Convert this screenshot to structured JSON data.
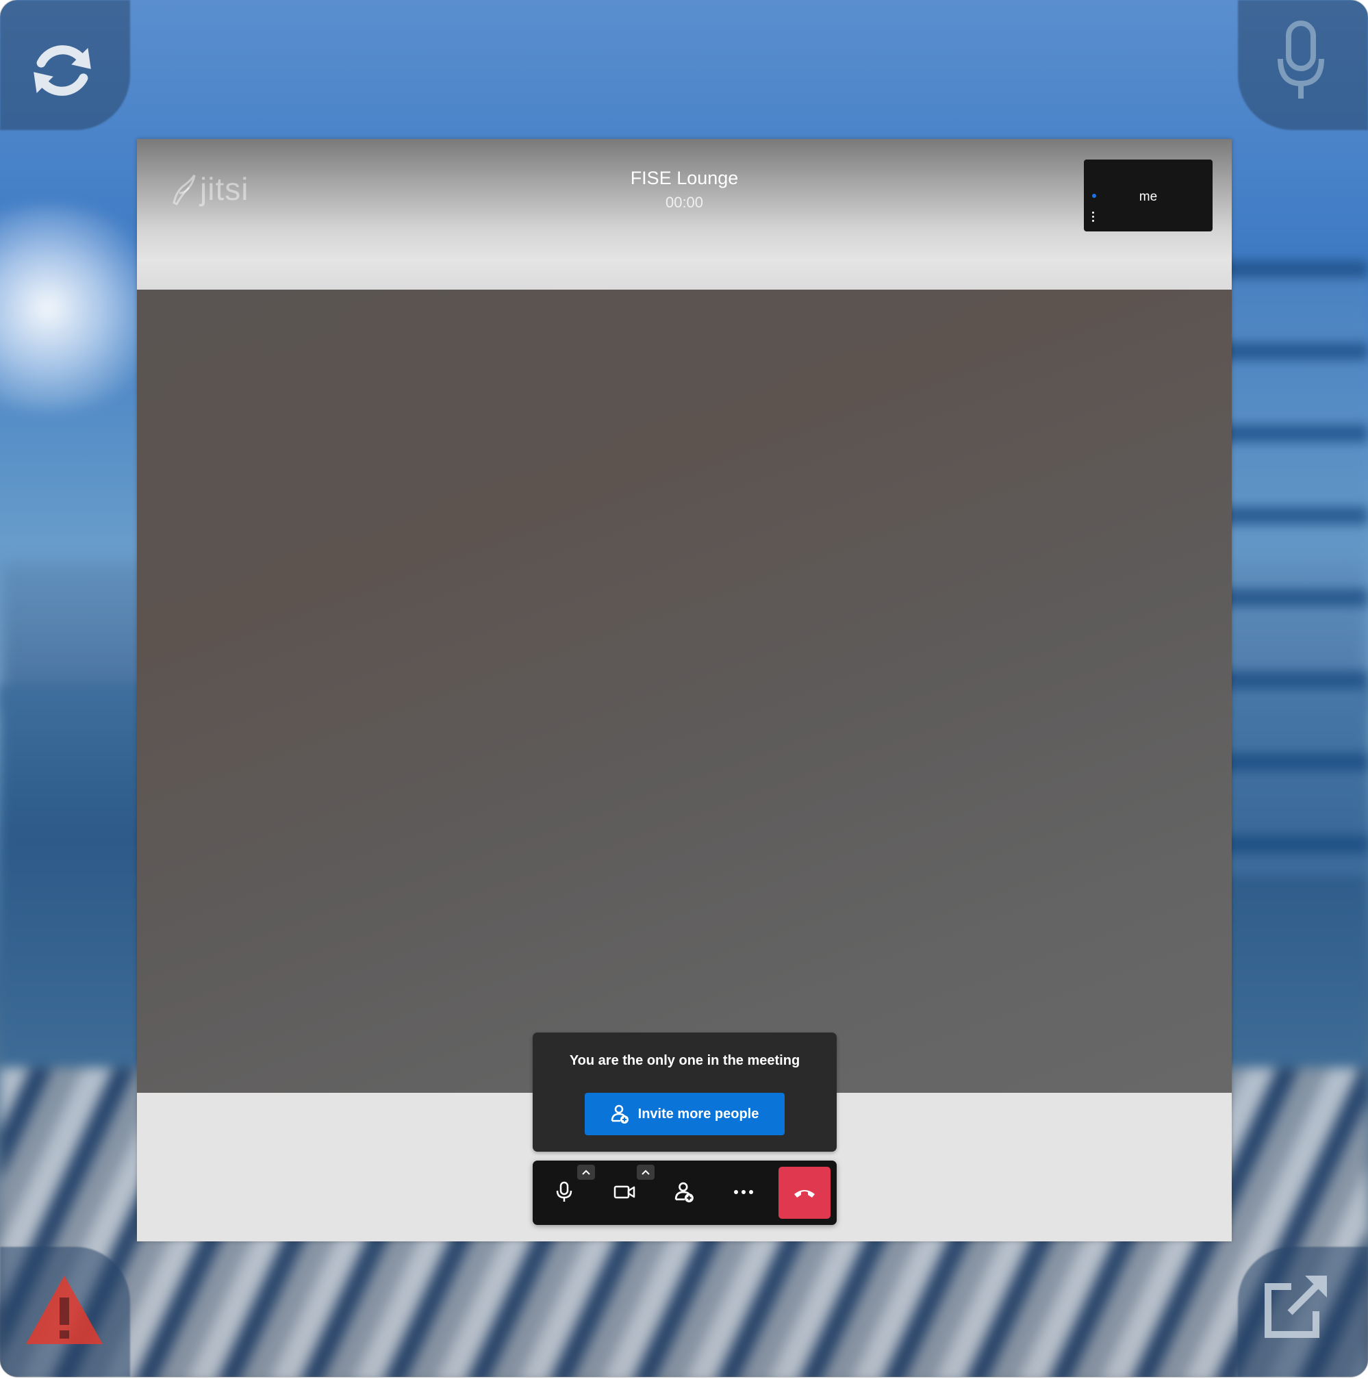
{
  "meeting": {
    "title": "FISE Lounge",
    "timer": "00:00",
    "logo_text": "jitsi"
  },
  "self_view": {
    "name": "me"
  },
  "notice": {
    "message": "You are the only one in the meeting",
    "invite_label": "Invite more people"
  },
  "toolbar": {
    "buttons": [
      "mic-icon",
      "camera-icon",
      "add-person-icon",
      "more-icon",
      "hangup-icon"
    ]
  },
  "colors": {
    "invite_blue": "#0a74d8",
    "hangup_red": "#e0394f",
    "toolbar_bg": "#141414"
  },
  "corner_icons": [
    "refresh-icon",
    "microphone-icon",
    "warning-icon",
    "popout-icon"
  ]
}
